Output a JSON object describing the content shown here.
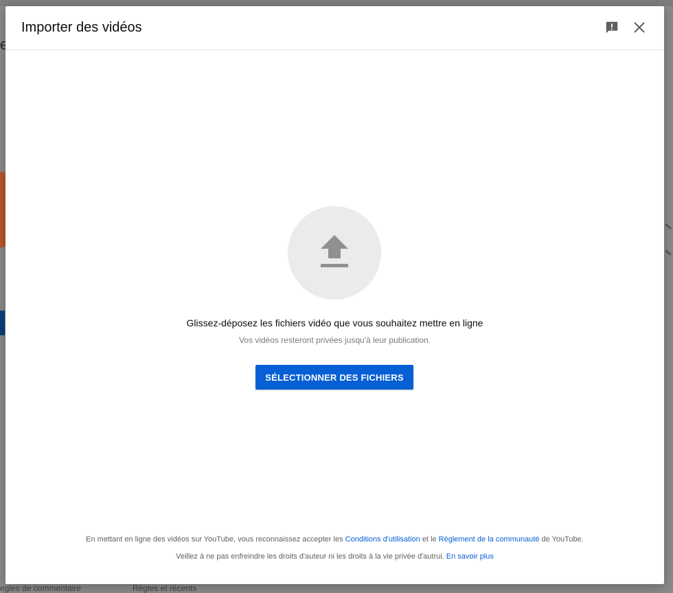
{
  "dialog": {
    "title": "Importer des vidéos",
    "drag_text": "Glissez-déposez les fichiers vidéo que vous souhaitez mettre en ligne",
    "private_text": "Vos vidéos resteront privées jusqu'à leur publication.",
    "select_button": "SÉLECTIONNER DES FICHIERS",
    "legal": {
      "line1_part1": "En mettant en ligne des vidéos sur YouTube, vous reconnaissez accepter les ",
      "terms_link": "Conditions d'utilisation",
      "line1_part2": " et le ",
      "community_link": "Règlement de la communauté",
      "line1_part3": " de YouTube.",
      "line2_text": "Veillez à ne pas enfreindre les droits d'auteur ni les droits à la vie privée d'autrui. ",
      "learn_more_link": "En savoir plus"
    }
  },
  "background": {
    "bottom_left": "egles de commentaire",
    "bottom_right": "Règles et récents"
  },
  "icons": {
    "feedback": "feedback-icon",
    "close": "close-icon",
    "upload": "upload-arrow-icon"
  },
  "colors": {
    "accent": "#065fd4",
    "upload_circle": "#ebebeb",
    "icon_gray": "#909090"
  }
}
